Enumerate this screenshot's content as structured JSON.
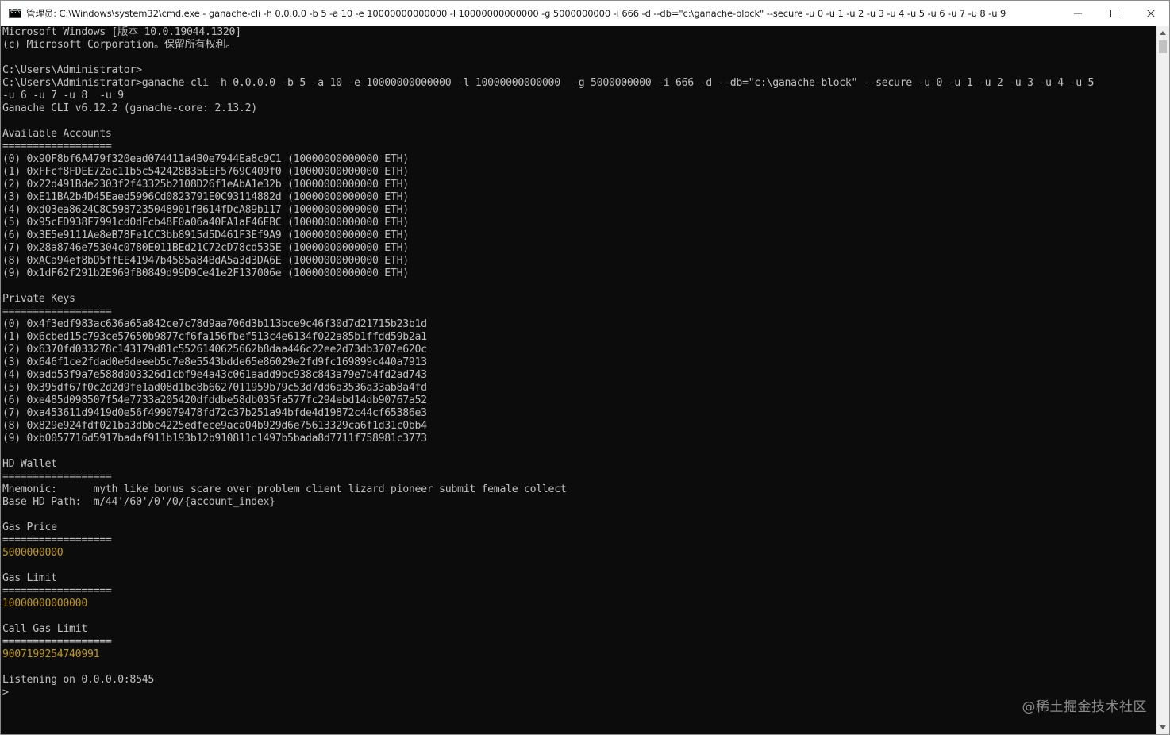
{
  "window": {
    "title": "管理员: C:\\Windows\\system32\\cmd.exe - ganache-cli  -h 0.0.0.0 -b 5 -a 10 -e 10000000000000 -l 10000000000000  -g 5000000000 -i 666 -d --db=\"c:\\ganache-block\" --secure -u 0 -u 1 -u 2 -u 3 -u 4 -u 5 -u 6 -u 7 -u 8  -u 9",
    "minimize_icon": "minimize-icon",
    "maximize_icon": "maximize-icon",
    "close_icon": "close-icon"
  },
  "terminal": {
    "lines": [
      {
        "text": "Microsoft Windows [版本 10.0.19044.1320]"
      },
      {
        "text": "(c) Microsoft Corporation。保留所有权利。"
      },
      {
        "text": ""
      },
      {
        "text": "C:\\Users\\Administrator>"
      },
      {
        "text": "C:\\Users\\Administrator>ganache-cli -h 0.0.0.0 -b 5 -a 10 -e 10000000000000 -l 10000000000000  -g 5000000000 -i 666 -d --db=\"c:\\ganache-block\" --secure -u 0 -u 1 -u 2 -u 3 -u 4 -u 5"
      },
      {
        "text": "-u 6 -u 7 -u 8  -u 9"
      },
      {
        "text": "Ganache CLI v6.12.2 (ganache-core: 2.13.2)"
      },
      {
        "text": ""
      },
      {
        "text": "Available Accounts"
      },
      {
        "text": "=================="
      },
      {
        "text": "(0) 0x90F8bf6A479f320ead074411a4B0e7944Ea8c9C1 (10000000000000 ETH)"
      },
      {
        "text": "(1) 0xFFcf8FDEE72ac11b5c542428B35EEF5769C409f0 (10000000000000 ETH)"
      },
      {
        "text": "(2) 0x22d491Bde2303f2f43325b2108D26f1eAbA1e32b (10000000000000 ETH)"
      },
      {
        "text": "(3) 0xE11BA2b4D45Eaed5996Cd0823791E0C93114882d (10000000000000 ETH)"
      },
      {
        "text": "(4) 0xd03ea8624C8C5987235048901fB614fDcA89b117 (10000000000000 ETH)"
      },
      {
        "text": "(5) 0x95cED938F7991cd0dFcb48F0a06a40FA1aF46EBC (10000000000000 ETH)"
      },
      {
        "text": "(6) 0x3E5e9111Ae8eB78Fe1CC3bb8915d5D461F3Ef9A9 (10000000000000 ETH)"
      },
      {
        "text": "(7) 0x28a8746e75304c0780E011BEd21C72cD78cd535E (10000000000000 ETH)"
      },
      {
        "text": "(8) 0xACa94ef8bD5ffEE41947b4585a84BdA5a3d3DA6E (10000000000000 ETH)"
      },
      {
        "text": "(9) 0x1dF62f291b2E969fB0849d99D9Ce41e2F137006e (10000000000000 ETH)"
      },
      {
        "text": ""
      },
      {
        "text": "Private Keys"
      },
      {
        "text": "=================="
      },
      {
        "text": "(0) 0x4f3edf983ac636a65a842ce7c78d9aa706d3b113bce9c46f30d7d21715b23b1d"
      },
      {
        "text": "(1) 0x6cbed15c793ce57650b9877cf6fa156fbef513c4e6134f022a85b1ffdd59b2a1"
      },
      {
        "text": "(2) 0x6370fd033278c143179d81c5526140625662b8daa446c22ee2d73db3707e620c"
      },
      {
        "text": "(3) 0x646f1ce2fdad0e6deeeb5c7e8e5543bdde65e86029e2fd9fc169899c440a7913"
      },
      {
        "text": "(4) 0xadd53f9a7e588d003326d1cbf9e4a43c061aadd9bc938c843a79e7b4fd2ad743"
      },
      {
        "text": "(5) 0x395df67f0c2d2d9fe1ad08d1bc8b6627011959b79c53d7dd6a3536a33ab8a4fd"
      },
      {
        "text": "(6) 0xe485d098507f54e7733a205420dfddbe58db035fa577fc294ebd14db90767a52"
      },
      {
        "text": "(7) 0xa453611d9419d0e56f499079478fd72c37b251a94bfde4d19872c44cf65386e3"
      },
      {
        "text": "(8) 0x829e924fdf021ba3dbbc4225edfece9aca04b929d6e75613329ca6f1d31c0bb4"
      },
      {
        "text": "(9) 0xb0057716d5917badaf911b193b12b910811c1497b5bada8d7711f758981c3773"
      },
      {
        "text": ""
      },
      {
        "text": "HD Wallet"
      },
      {
        "text": "=================="
      },
      {
        "text": "Mnemonic:      myth like bonus scare over problem client lizard pioneer submit female collect"
      },
      {
        "text": "Base HD Path:  m/44'/60'/0'/0/{account_index}"
      },
      {
        "text": ""
      },
      {
        "text": "Gas Price"
      },
      {
        "text": "=================="
      },
      {
        "text": "5000000000",
        "color": "yellow"
      },
      {
        "text": ""
      },
      {
        "text": "Gas Limit"
      },
      {
        "text": "=================="
      },
      {
        "text": "10000000000000",
        "color": "yellow"
      },
      {
        "text": ""
      },
      {
        "text": "Call Gas Limit"
      },
      {
        "text": "=================="
      },
      {
        "text": "9007199254740991",
        "color": "yellow"
      },
      {
        "text": ""
      },
      {
        "text": "Listening on 0.0.0.0:8545"
      },
      {
        "text": ">"
      }
    ]
  },
  "watermark": "@稀土掘金技术社区",
  "colors": {
    "background": "#0c0c0c",
    "text": "#c0c0c0",
    "highlight": "#c19c00"
  }
}
